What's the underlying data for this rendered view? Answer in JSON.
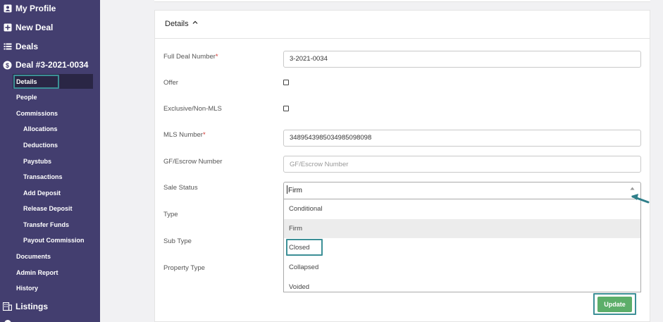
{
  "sidebar": {
    "top_items": [
      {
        "label": "My Profile",
        "icon": "user-icon"
      },
      {
        "label": "New Deal",
        "icon": "plus-square-icon"
      },
      {
        "label": "Deals",
        "icon": "list-icon"
      },
      {
        "label": "Deal #3-2021-0034",
        "icon": "dollar-circle-icon"
      }
    ],
    "deal_items": [
      "Details",
      "People",
      "Commissions"
    ],
    "commission_items": [
      "Allocations",
      "Deductions",
      "Paystubs",
      "Transactions",
      "Add Deposit",
      "Release Deposit",
      "Transfer Funds",
      "Payout Commission"
    ],
    "more_items": [
      "Documents",
      "Admin Report",
      "History"
    ],
    "listings": {
      "label": "Listings",
      "icon": "building-icon"
    }
  },
  "details": {
    "header": "Details",
    "fields": {
      "full_deal_number": {
        "label": "Full Deal Number",
        "value": "3-2021-0034"
      },
      "offer": {
        "label": "Offer"
      },
      "exclusive": {
        "label": "Exclusive/Non-MLS"
      },
      "mls_number": {
        "label": "MLS Number",
        "value": "3489543985034985098098"
      },
      "gf_escrow": {
        "label": "GF/Escrow Number",
        "placeholder": "GF/Escrow Number"
      },
      "sale_status": {
        "label": "Sale Status",
        "value": "Firm"
      },
      "type": {
        "label": "Type"
      },
      "sub_type": {
        "label": "Sub Type"
      },
      "property_type": {
        "label": "Property Type"
      }
    },
    "required_mark": "*",
    "sale_status_options": [
      "Conditional",
      "Firm",
      "Closed",
      "Collapsed",
      "Voided"
    ],
    "selected_option": "Firm",
    "update_label": "Update"
  },
  "colors": {
    "sidebar_bg": "#433e6f",
    "highlight": "#3c8f96",
    "update_btn": "#5cae6a"
  }
}
